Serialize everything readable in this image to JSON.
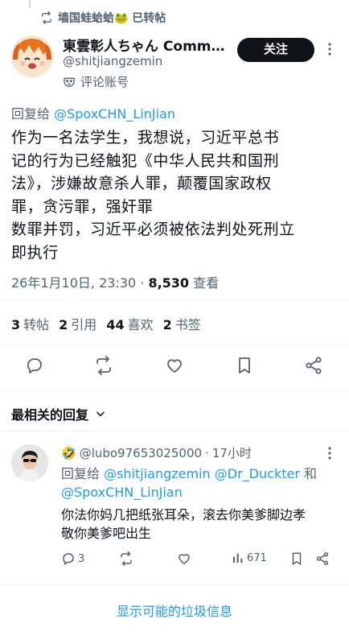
{
  "repost_context": {
    "text": "墙国蛙蛤蛤🐸 已转帖"
  },
  "author": {
    "display_name": "東雲彰人ちゃん Comm…",
    "handle": "@shitjiangzemin",
    "badge_label": "评论账号"
  },
  "follow_button": {
    "label": "关注"
  },
  "reply_to": {
    "prefix": "回复给 ",
    "user": "@SpoxCHN_LinJian"
  },
  "tweet": {
    "text": "作为一名法学生，我想说，习近平总书\n记的行为已经触犯《中华人民共和国刑\n法》，涉嫌故意杀人罪，颠覆国家政权\n罪，贪污罪，强奸罪\n数罪并罚，习近平必须被依法判处死刑立\n即执行",
    "timestamp": "26年1月10日, 23:30",
    "views_count": "8,530",
    "views_label": "查看"
  },
  "stats": {
    "reposts": {
      "count": "3",
      "label": "转帖"
    },
    "quotes": {
      "count": "2",
      "label": "引用"
    },
    "likes": {
      "count": "44",
      "label": "喜欢"
    },
    "bookmarks": {
      "count": "2",
      "label": "书签"
    }
  },
  "action_icons": [
    "reply-icon",
    "repost-icon",
    "like-icon",
    "bookmark-icon",
    "share-icon"
  ],
  "replies_section": {
    "sort_label": "最相关的回复"
  },
  "reply": {
    "emoji": "🤣",
    "handle": "@lubo97653025000",
    "separator": "·",
    "time": "17小时",
    "reply_to_prefix": "回复给 ",
    "reply_to_user1": "@shitjiangzemin",
    "reply_to_user2": "@Dr_Duckter",
    "reply_to_and": " 和",
    "reply_to_user3": "@SpoxCHN_LinJian",
    "text": "你法你妈几把纸张耳朵，滚去你美爹脚边孝\n敬你美爹吧出生",
    "reply_count": "3",
    "views_count": "671"
  },
  "spam_link": {
    "label": "显示可能的垃圾信息"
  },
  "colors": {
    "accent": "#1d9bf0",
    "text": "#0f1419",
    "muted": "#536471",
    "button_bg": "#0f1419"
  }
}
